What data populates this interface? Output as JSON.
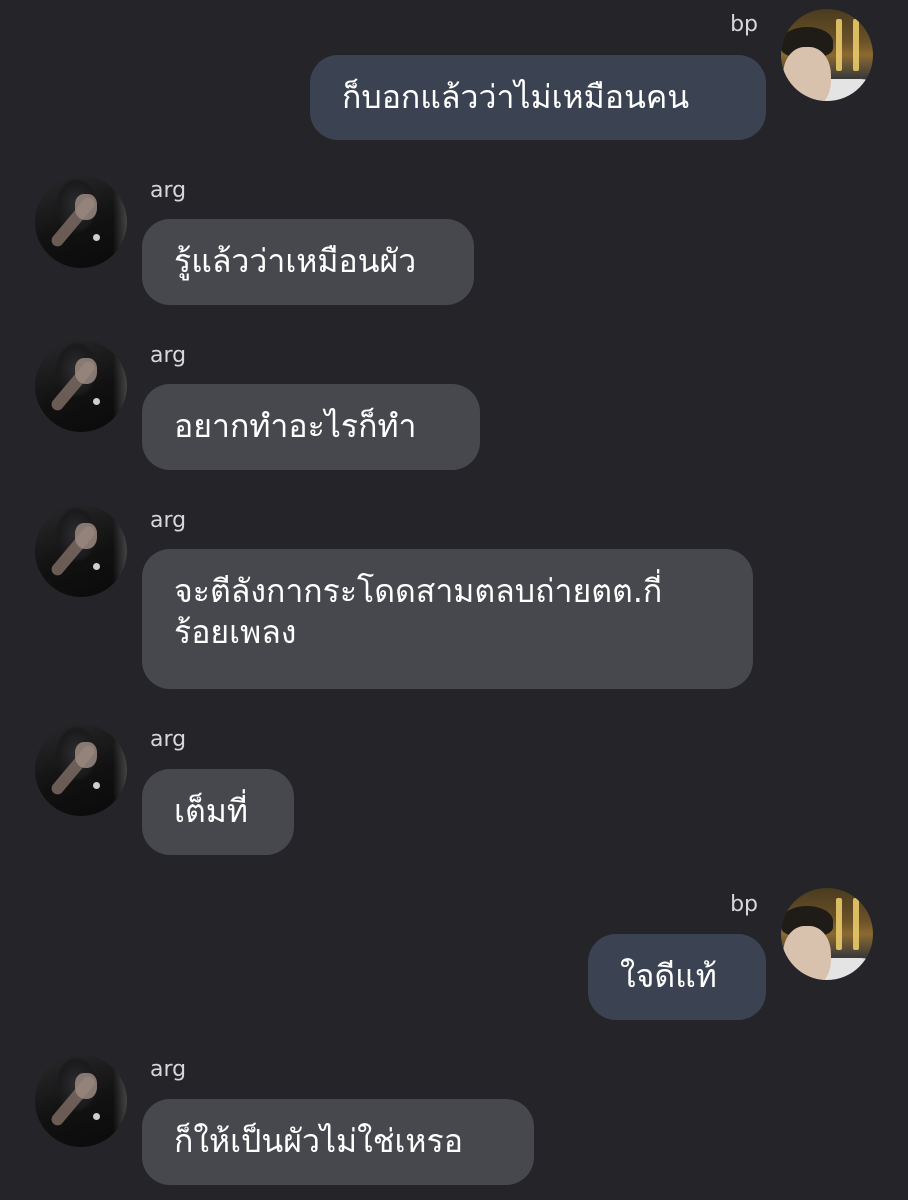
{
  "messages": [
    {
      "sender": "bp",
      "direction": "outgoing",
      "lines": [
        "ก็บอกแล้วว่าไม่เหมือนคน"
      ]
    },
    {
      "sender": "arg",
      "direction": "incoming",
      "lines": [
        "รู้แล้วว่าเหมือนผัว"
      ]
    },
    {
      "sender": "arg",
      "direction": "incoming",
      "lines": [
        "อยากทำอะไรก็ทำ"
      ]
    },
    {
      "sender": "arg",
      "direction": "incoming",
      "lines": [
        "จะตีลังกากระโดดสามตลบถ่ายตต.กี่",
        "ร้อยเพลง"
      ]
    },
    {
      "sender": "arg",
      "direction": "incoming",
      "lines": [
        "เต็มที่"
      ]
    },
    {
      "sender": "bp",
      "direction": "outgoing",
      "lines": [
        "ใจดีแท้"
      ]
    },
    {
      "sender": "arg",
      "direction": "incoming",
      "lines": [
        "ก็ให้เป็นผัวไม่ใช่เหรอ"
      ]
    }
  ],
  "colors": {
    "background": "#242429",
    "incoming_bubble": "#47484d",
    "outgoing_bubble": "#3b4352",
    "text": "#ffffff",
    "sender_name": "#d7d7db"
  }
}
